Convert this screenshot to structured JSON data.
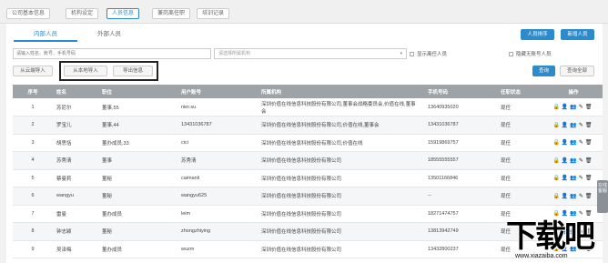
{
  "topnav": {
    "tabs": [
      "公司基本信息",
      "机构设定",
      "人员信息",
      "兼岗离任职",
      "培训记录"
    ],
    "active_index": 2
  },
  "subtabs": [
    "内部人员",
    "外部人员"
  ],
  "buttons": {
    "sort": "人员排序",
    "add": "新增人员",
    "import_cloud": "从云端导入",
    "import_local": "从本地导入",
    "export": "导出信息",
    "search": "查询",
    "search_all": "查询全部"
  },
  "filters": {
    "keyword_placeholder": "请输入姓名、账号、手机号码",
    "org_placeholder": "请选择所属机构",
    "show_resigned": "显示离任人员",
    "hide_no_account": "隐藏无账号人员"
  },
  "table": {
    "headers": [
      "序号",
      "姓名",
      "职位",
      "用户账号",
      "所属机构",
      "手机号码",
      "任职状态",
      "操作"
    ],
    "rows": [
      [
        "1",
        "苏尼尔",
        "董事,55",
        "nier.su",
        "深圳价值在线信息科技股份有限公司,董事会战略委员会,价值在线,董事会",
        "13640935020",
        "现任"
      ],
      [
        "2",
        "罗宝儿",
        "董事,44",
        "13431036787",
        "深圳价值在线信息科技股份有限公司,价值在线,董事会",
        "13431036787",
        "现任"
      ],
      [
        "3",
        "胡思恬",
        "董办成员,33",
        "cici",
        "深圳价值在线信息科技股份有限公司,价值在线",
        "15919869757",
        "现任"
      ],
      [
        "4",
        "苏秀清",
        "董事",
        "苏秀清",
        "深圳价值在线信息科技股份有限公司",
        "18555555557",
        "现任"
      ],
      [
        "5",
        "蔡曼莉",
        "董秘",
        "caimanli",
        "深圳价值在线信息科技股份有限公司",
        "13501166846",
        "现任"
      ],
      [
        "6",
        "wangyu",
        "董秘",
        "wangyu625",
        "深圳价值在线信息科技股份有限公司",
        "--",
        "现任"
      ],
      [
        "7",
        "雷曼",
        "董办成员",
        "leim",
        "深圳价值在线信息科技股份有限公司",
        "18271474757",
        "现任"
      ],
      [
        "8",
        "钟志颖",
        "董秘",
        "zhongzhiying",
        "深圳价值在线信息科技股份有限公司",
        "13813942749",
        "现任"
      ],
      [
        "9",
        "吴泽梅",
        "董办成员",
        "wuzm",
        "深圳价值在线信息科技股份有限公司",
        "13432800237",
        "现任"
      ]
    ]
  },
  "side": {
    "text": "在线客服"
  },
  "watermark": {
    "big": "下载吧",
    "small": "www.xiazaiba.com"
  },
  "colors": {
    "accent": "#2b8bcb",
    "header_bg": "#9ea3a8"
  }
}
